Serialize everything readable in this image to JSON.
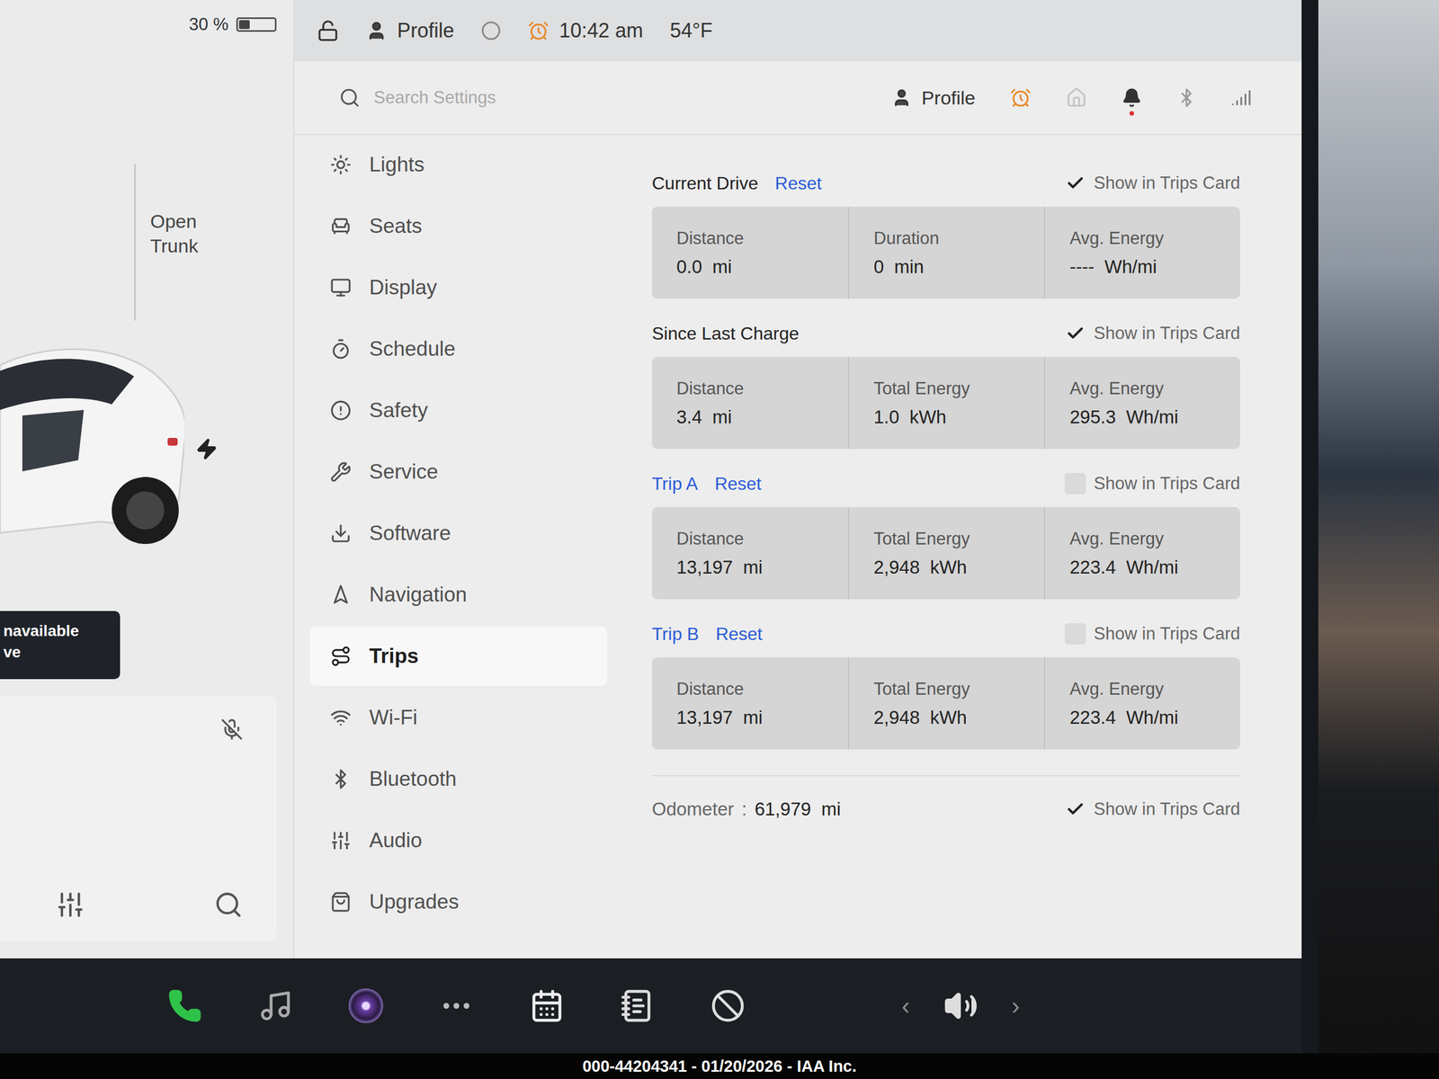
{
  "status_bar": {
    "battery": "30 %",
    "battery_level": 0.3,
    "profile": "Profile",
    "time": "10:42 am",
    "temperature": "54°F"
  },
  "car_panel": {
    "trunk_label": "Open Trunk",
    "toast": [
      "navailable",
      "ve"
    ]
  },
  "search": {
    "placeholder": "Search Settings"
  },
  "header": {
    "profile": "Profile",
    "has_notification": true
  },
  "sidebar": {
    "items": [
      {
        "label": "Lights",
        "selected": false
      },
      {
        "label": "Seats",
        "selected": false
      },
      {
        "label": "Display",
        "selected": false
      },
      {
        "label": "Schedule",
        "selected": false
      },
      {
        "label": "Safety",
        "selected": false
      },
      {
        "label": "Service",
        "selected": false
      },
      {
        "label": "Software",
        "selected": false
      },
      {
        "label": "Navigation",
        "selected": false
      },
      {
        "label": "Trips",
        "selected": true
      },
      {
        "label": "Wi-Fi",
        "selected": false
      },
      {
        "label": "Bluetooth",
        "selected": false
      },
      {
        "label": "Audio",
        "selected": false
      },
      {
        "label": "Upgrades",
        "selected": false
      }
    ]
  },
  "sections": [
    {
      "title": "Current Drive",
      "link": false,
      "reset": "Reset",
      "show_label": "Show in Trips Card",
      "checked": true,
      "stats": [
        {
          "label": "Distance",
          "value": "0.0  mi"
        },
        {
          "label": "Duration",
          "value": "0  min"
        },
        {
          "label": "Avg. Energy",
          "value": "----  Wh/mi"
        }
      ]
    },
    {
      "title": "Since Last Charge",
      "link": false,
      "show_label": "Show in Trips Card",
      "checked": true,
      "stats": [
        {
          "label": "Distance",
          "value": "3.4  mi"
        },
        {
          "label": "Total Energy",
          "value": "1.0  kWh"
        },
        {
          "label": "Avg. Energy",
          "value": "295.3  Wh/mi"
        }
      ]
    },
    {
      "title": "Trip A",
      "link": true,
      "reset": "Reset",
      "show_label": "Show in Trips Card",
      "checked": false,
      "stats": [
        {
          "label": "Distance",
          "value": "13,197  mi"
        },
        {
          "label": "Total Energy",
          "value": "2,948  kWh"
        },
        {
          "label": "Avg. Energy",
          "value": "223.4  Wh/mi"
        }
      ]
    },
    {
      "title": "Trip B",
      "link": true,
      "reset": "Reset",
      "show_label": "Show in Trips Card",
      "checked": false,
      "stats": [
        {
          "label": "Distance",
          "value": "13,197  mi"
        },
        {
          "label": "Total Energy",
          "value": "2,948  kWh"
        },
        {
          "label": "Avg. Energy",
          "value": "223.4  Wh/mi"
        }
      ]
    }
  ],
  "odometer": {
    "label": "Odometer",
    "separator": ":",
    "value": "61,979  mi",
    "show_label": "Show in Trips Card",
    "checked": true
  },
  "dock": {
    "prev": "‹",
    "next": "›"
  },
  "footer": "000-44204341 - 01/20/2026 - IAA Inc."
}
